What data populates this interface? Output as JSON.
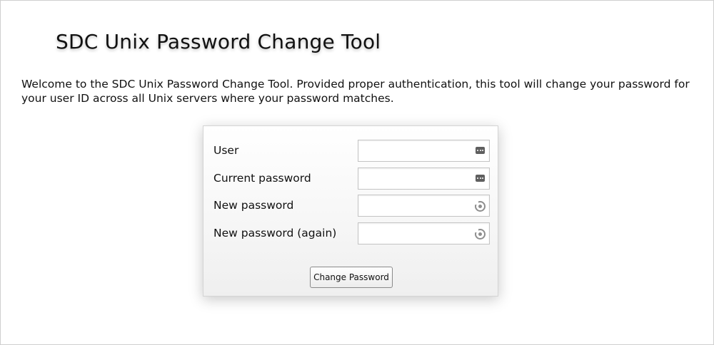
{
  "page": {
    "title": "SDC Unix Password Change Tool",
    "intro": "Welcome to the SDC Unix Password Change Tool. Provided proper authentication, this tool will change your password for your user ID across all Unix servers where your password matches."
  },
  "form": {
    "fields": [
      {
        "label": "User",
        "value": "",
        "icon": "password-manager-key-icon"
      },
      {
        "label": "Current password",
        "value": "",
        "icon": "password-manager-key-icon"
      },
      {
        "label": "New password",
        "value": "",
        "icon": "password-generator-icon"
      },
      {
        "label": "New password (again)",
        "value": "",
        "icon": "password-generator-icon"
      }
    ],
    "submit_label": "Change Password"
  },
  "colors": {
    "text": "#111111",
    "panel_border": "#d4d4d4",
    "field_border": "#c4c4c4",
    "button_border": "#8a8a8a"
  }
}
